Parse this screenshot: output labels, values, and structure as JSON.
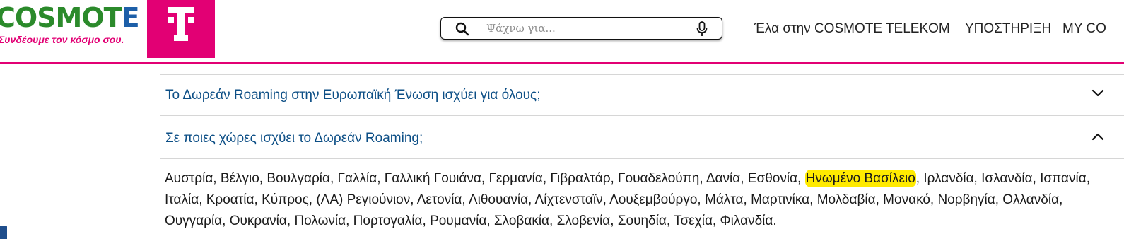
{
  "header": {
    "logo": {
      "word_part1": "COSMOT",
      "word_part2": "E",
      "slogan": "Συνδέουμε τον κόσμο σου."
    },
    "search": {
      "placeholder": "Ψάχνω για..."
    },
    "nav": [
      "Έλα στην COSMOTE TELEKOM",
      "ΥΠΟΣΤΗΡΙΞΗ",
      "MY CO"
    ]
  },
  "faq": [
    {
      "question": "Το Δωρεάν Roaming στην Ευρωπαϊκή Ένωση ισχύει για όλους;",
      "expanded": false
    },
    {
      "question": "Σε ποιες χώρες ισχύει το Δωρεάν Roaming;",
      "expanded": true,
      "answer_before": "Αυστρία, Βέλγιο, Βουλγαρία, Γαλλία, Γαλλική Γουιάνα, Γερμανία, Γιβραλτάρ, Γουαδελούπη, Δανία, Εσθονία, ",
      "answer_highlight": "Ηνωμένο Βασίλειο",
      "answer_after": ", Ιρλανδία, Ισλανδία, Ισπανία, Ιταλία, Κροατία, Κύπρος, (ΛΑ) Ρεγιούνιον, Λετονία, Λιθουανία, Λίχτενσταϊν, Λουξεμβούργο, Μάλτα, Μαρτινίκα, Μολδαβία, Μονακό, Νορβηγία, Ολλανδία, Ουγγαρία, Ουκρανία, Πολωνία, Πορτογαλία, Ρουμανία, Σλοβακία, Σλοβενία, Σουηδία, Τσεχία, Φιλανδία."
    }
  ],
  "colors": {
    "brand_magenta": "#e20074",
    "link_blue": "#0d4f86",
    "highlight_yellow": "#ffea00"
  }
}
